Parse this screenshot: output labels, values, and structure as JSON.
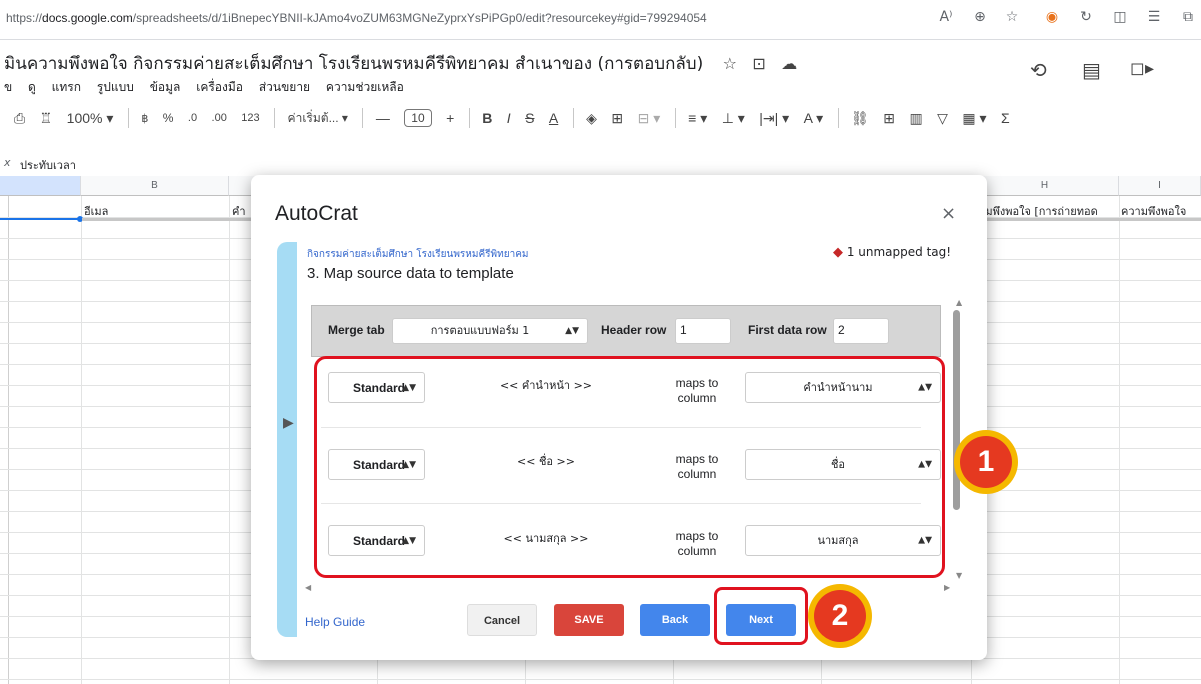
{
  "browser": {
    "url_prefix": "https://",
    "url_domain": "docs.google.com",
    "url_path": "/spreadsheets/d/1iBnepecYBNII-kJAmo4voZUM63MGNeZyprxYsPiPGp0/edit?resourcekey#gid=799294054",
    "icons": [
      "read-aloud-icon",
      "zoom-icon",
      "favorite-icon",
      "extension-icon",
      "refresh-icon",
      "split-screen-icon",
      "favorites-bar-icon",
      "collections-icon"
    ]
  },
  "sheet": {
    "title": "มินความพึงพอใจ กิจกรรมค่ายสะเต็มศึกษา โรงเรียนพรหมคีรีพิทยาคม สำเนาของ (การตอบกลับ)",
    "menu": [
      "ข",
      "ดู",
      "แทรก",
      "รูปแบบ",
      "ข้อมูล",
      "เครื่องมือ",
      "ส่วนขยาย",
      "ความช่วยเหลือ"
    ],
    "toolbar": {
      "zoom": "100%",
      "currency": "฿",
      "percent": "%",
      "dec_less": ".0",
      "dec_more": ".00",
      "format_num": "123",
      "font": "ค่าเริ่มต้...",
      "minus": "—",
      "font_size": "10",
      "plus": "+",
      "bold": "B",
      "italic": "I",
      "strike": "S",
      "textcolor": "A",
      "sigma": "Σ"
    },
    "formula_ref": "x",
    "formula_value": "ประทับเวลา",
    "col_b": "B",
    "col_h": "H",
    "col_i": "I",
    "cell_b1": "อีเมล",
    "cell_c1": "คำ",
    "cell_h1": "วามพึงพอใจ [การถ่ายทอด",
    "cell_i1": "ความพึงพอใจ"
  },
  "dialog": {
    "title": "AutoCrat",
    "close": "×",
    "subtitle": "กิจกรรมค่ายสะเต็มศึกษา โรงเรียนพรหมคีรีพิทยาคม",
    "step": "3. Map source data to template",
    "unmapped": "1 unmapped tag!",
    "merge_tab_label": "Merge tab",
    "merge_tab_value": "การตอบแบบฟอร์ม 1",
    "header_row_label": "Header row",
    "header_row_value": "1",
    "first_data_row_label": "First data row",
    "first_data_row_value": "2",
    "mappings": [
      {
        "type": "Standard",
        "tag": "<< คำนำหน้า >>",
        "maps_to": "maps to column",
        "column": "คำนำหน้านาม"
      },
      {
        "type": "Standard",
        "tag": "<< ชื่อ >>",
        "maps_to": "maps to column",
        "column": "ชื่อ"
      },
      {
        "type": "Standard",
        "tag": "<< นามสกุล >>",
        "maps_to": "maps to column",
        "column": "นามสกุล"
      }
    ],
    "help": "Help Guide",
    "buttons": {
      "cancel": "Cancel",
      "save": "SAVE",
      "back": "Back",
      "next": "Next"
    }
  },
  "annotations": {
    "badge1": "1",
    "badge2": "2"
  },
  "colors": {
    "save": "#d9453b",
    "primary": "#4386ec",
    "highlight": "#e0121f",
    "badge_ring": "#f5b800",
    "badge_fill": "#e53920",
    "sidebar": "#a6dcf4"
  }
}
